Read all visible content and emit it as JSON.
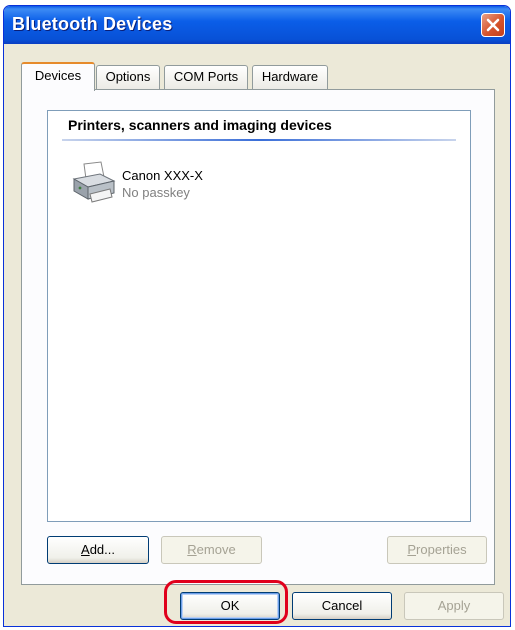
{
  "window": {
    "title": "Bluetooth Devices"
  },
  "tabs": [
    {
      "label": "Devices",
      "active": true
    },
    {
      "label": "Options",
      "active": false
    },
    {
      "label": "COM Ports",
      "active": false
    },
    {
      "label": "Hardware",
      "active": false
    }
  ],
  "panel": {
    "group_title": "Printers, scanners and imaging devices",
    "devices": [
      {
        "name": "Canon XXX-X",
        "status": "No passkey",
        "icon": "printer-icon"
      }
    ],
    "buttons": {
      "add": {
        "label_underline": "A",
        "label_rest": "dd..."
      },
      "remove": {
        "label_underline": "R",
        "label_rest": "emove"
      },
      "properties": {
        "label_underline": "P",
        "label_rest": "roperties"
      }
    }
  },
  "footer": {
    "ok": "OK",
    "cancel": "Cancel",
    "apply": "Apply"
  },
  "colors": {
    "title_bar": "#0a58e6",
    "close_button": "#d6542c",
    "highlight": "#e0001c",
    "active_tab_accent": "#e68b2c"
  }
}
